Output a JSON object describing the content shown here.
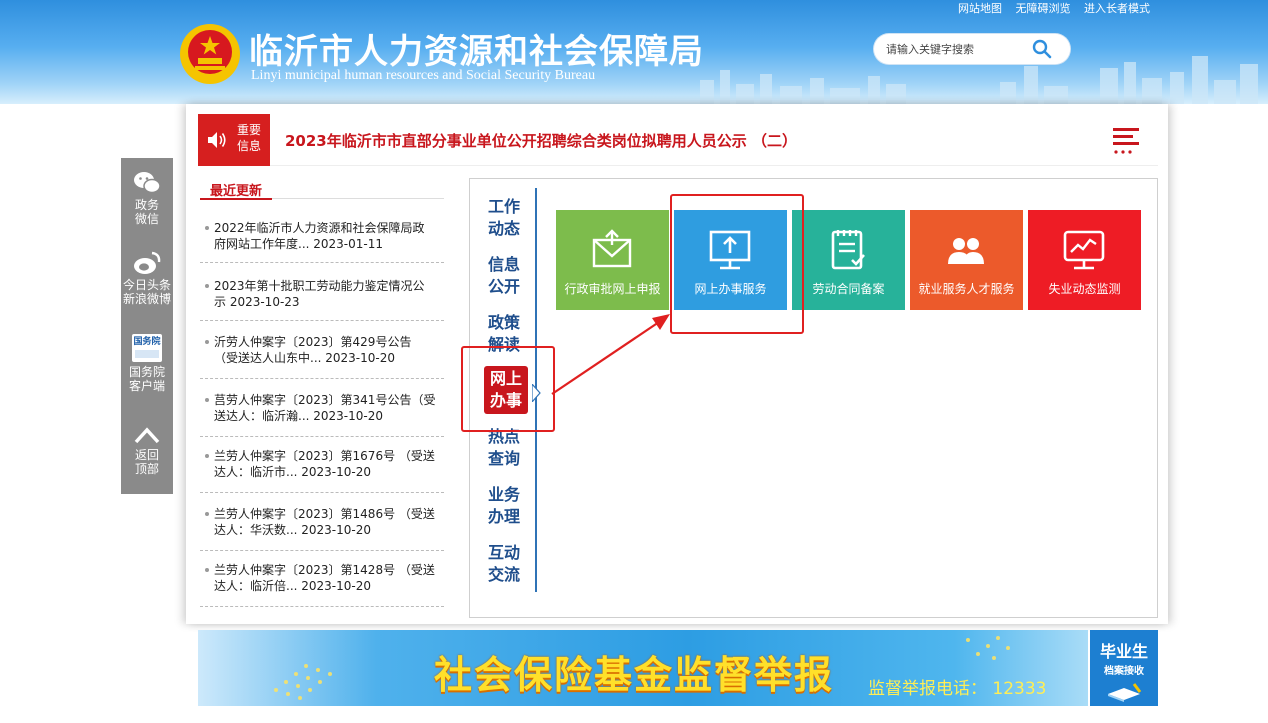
{
  "header": {
    "top_links": [
      "网站地图",
      "无障碍浏览",
      "进入长者模式"
    ],
    "title": "临沂市人力资源和社会保障局",
    "subtitle": "Linyi municipal human resources and Social Security Bureau",
    "search": {
      "placeholder": "请输入关键字搜索",
      "icon": "search-icon"
    }
  },
  "notice": {
    "badge_line1": "重要",
    "badge_line2": "信息",
    "text": "2023年临沂市市直部分事业单位公开招聘综合类岗位拟聘用人员公示 （二）",
    "icon": "speaker-icon",
    "menu_icon": "menu-icon"
  },
  "floatbar": {
    "items": [
      {
        "label1": "政务",
        "label2": "微信",
        "icon": "wechat-icon"
      },
      {
        "label1": "今日头条",
        "label2": "新浪微博",
        "icon": "weibo-icon"
      },
      {
        "label1": "国务院",
        "label2": "客户端",
        "icon": "state-council-icon",
        "icon_text": "国务院"
      },
      {
        "label1": "返回",
        "label2": "顶部",
        "icon": "chevron-up-icon"
      }
    ]
  },
  "recent": {
    "title": "最近更新",
    "items": [
      {
        "line1": "2022年临沂市人力资源和社会保障局政",
        "line2": "府网站工作年度... 2023-01-11"
      },
      {
        "line1": "2023年第十批职工劳动能力鉴定情况公",
        "line2": "示 2023-10-23"
      },
      {
        "line1": "沂劳人仲案字〔2023〕第429号公告",
        "line2": "（受送达人山东中... 2023-10-20"
      },
      {
        "line1": "莒劳人仲案字〔2023〕第341号公告（受",
        "line2": "送达人：临沂瀚... 2023-10-20"
      },
      {
        "line1": "兰劳人仲案字〔2023〕第1676号 （受送",
        "line2": "达人：临沂市... 2023-10-20"
      },
      {
        "line1": "兰劳人仲案字〔2023〕第1486号 （受送",
        "line2": "达人：华沃数... 2023-10-20"
      },
      {
        "line1": "兰劳人仲案字〔2023〕第1428号 （受送",
        "line2": "达人：临沂倍... 2023-10-20"
      }
    ]
  },
  "tabs": [
    {
      "line1": "工作",
      "line2": "动态"
    },
    {
      "line1": "信息",
      "line2": "公开"
    },
    {
      "line1": "政策",
      "line2": "解读"
    },
    {
      "line1": "网上",
      "line2": "办事",
      "active": true
    },
    {
      "line1": "热点",
      "line2": "查询"
    },
    {
      "line1": "业务",
      "line2": "办理"
    },
    {
      "line1": "互动",
      "line2": "交流"
    }
  ],
  "tiles": [
    {
      "label": "行政审批网上申报",
      "icon": "mail-upload-icon",
      "color": "#7dbc4c"
    },
    {
      "label": "网上办事服务",
      "icon": "monitor-upload-icon",
      "color": "#2f9de0"
    },
    {
      "label": "劳动合同备案",
      "icon": "clipboard-check-icon",
      "color": "#27b29a"
    },
    {
      "label": "就业服务人才服务",
      "icon": "users-icon",
      "color": "#ec5a2b"
    },
    {
      "label": "失业动态监测",
      "icon": "chart-monitor-icon",
      "color": "#ee1c25"
    }
  ],
  "banner": {
    "title": "社会保险基金监督举报",
    "phone": "监督举报电话：  12333",
    "grad_title": "毕业生",
    "grad_sub": "档案接收"
  },
  "colors": {
    "accent_red": "#c8161d",
    "nav_blue": "#1f4e8c",
    "annotation_red": "#e02020"
  }
}
